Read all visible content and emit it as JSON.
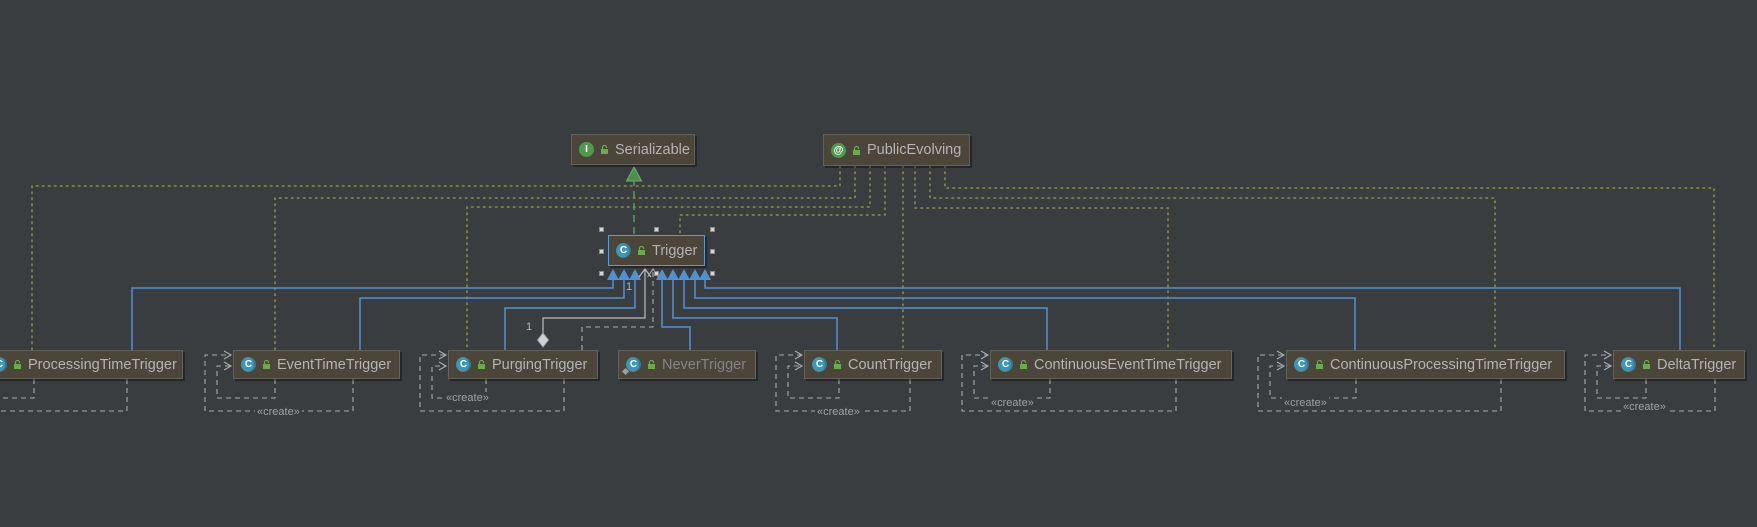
{
  "nodes": [
    {
      "label": "Serializable",
      "type": "interface"
    },
    {
      "label": "PublicEvolving",
      "type": "annotation"
    },
    {
      "label": "Trigger",
      "type": "class",
      "state": "selected"
    },
    {
      "label": "ProcessingTimeTrigger",
      "type": "class"
    },
    {
      "label": "EventTimeTrigger",
      "type": "class"
    },
    {
      "label": "PurgingTrigger",
      "type": "class"
    },
    {
      "label": "NeverTrigger",
      "type": "class",
      "state": "muted"
    },
    {
      "label": "CountTrigger",
      "type": "class"
    },
    {
      "label": "ContinuousEventTimeTrigger",
      "type": "class"
    },
    {
      "label": "ContinuousProcessingTimeTrigger",
      "type": "class"
    },
    {
      "label": "DeltaTrigger",
      "type": "class"
    }
  ],
  "icon_glyphs": {
    "class": "C",
    "interface": "I",
    "annotation": "@"
  },
  "edge_labels": {
    "create": "«create»",
    "multiplicity_one": "1"
  },
  "colors": {
    "background": "#393d40",
    "node_background": "#4b453a",
    "node_border": "#63625a",
    "selection_blue": "#5b9bd5",
    "inheritance_blue": "#5191d1",
    "create_dashed_gray": "#a9adb0",
    "annotation_dotted_olive": "#8f8f45",
    "realization_green": "#5ba35f",
    "class_icon_teal": "#3d96b4",
    "interface_icon_green": "#4d9b4d",
    "label_text": "#b4b4b4",
    "muted_label_text": "#848484"
  }
}
